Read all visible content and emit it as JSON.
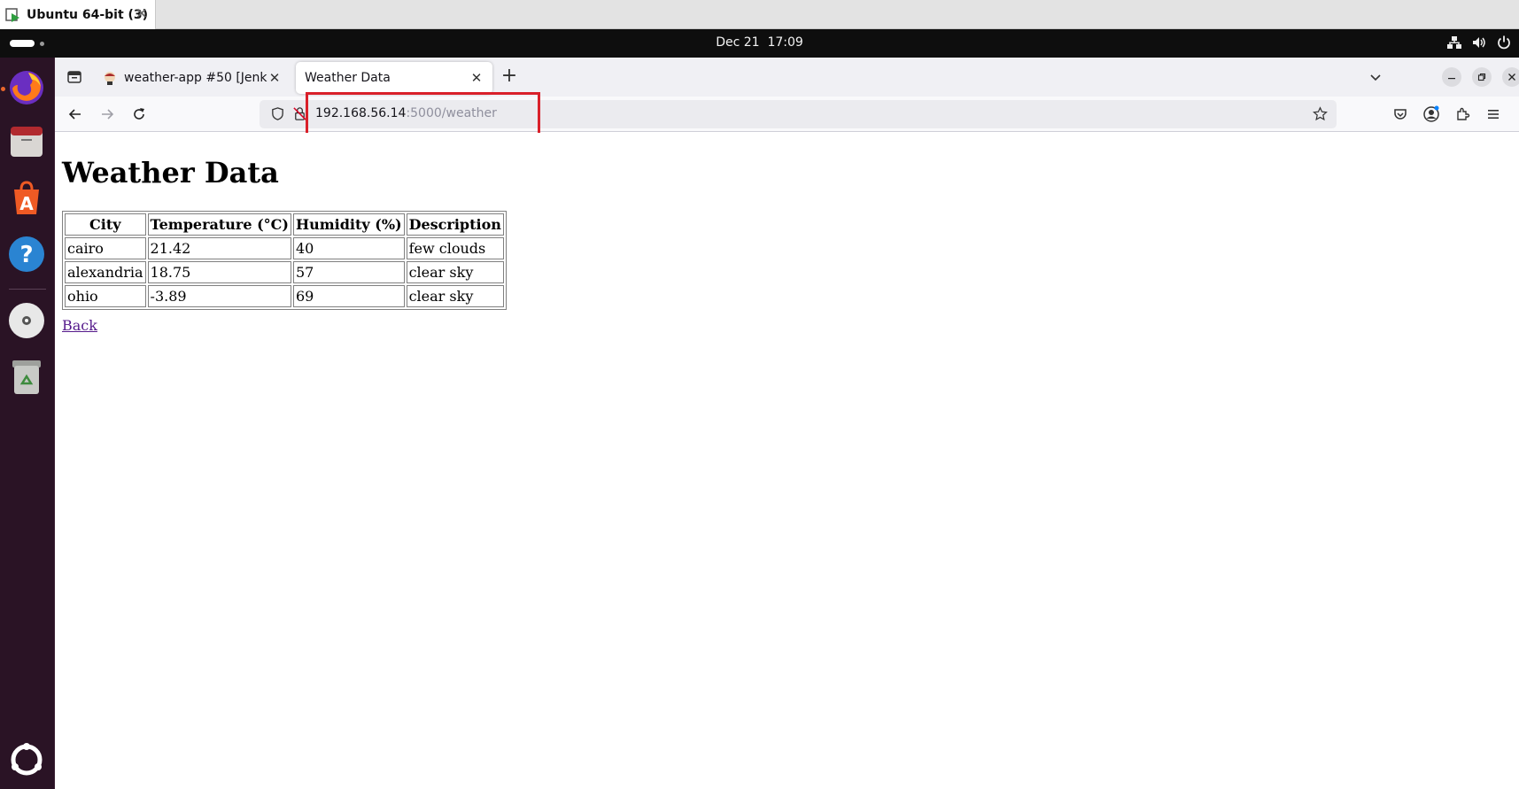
{
  "vm_window": {
    "title": "Ubuntu 64-bit (3)",
    "close_glyph": "✕"
  },
  "top_panel": {
    "date": "Dec 21",
    "time": "17:09"
  },
  "browser": {
    "tabs": [
      {
        "label": "weather-app #50 [Jenkins]",
        "active": false
      },
      {
        "label": "Weather Data",
        "active": true
      }
    ],
    "tab_close_glyph": "✕",
    "new_tab_glyph": "+",
    "url": {
      "host": "192.168.56.14",
      "rest": ":5000/weather"
    }
  },
  "page": {
    "heading": "Weather Data",
    "table": {
      "headers": [
        "City",
        "Temperature (°C)",
        "Humidity (%)",
        "Description"
      ],
      "rows": [
        [
          "cairo",
          "21.42",
          "40",
          "few clouds"
        ],
        [
          "alexandria",
          "18.75",
          "57",
          "clear sky"
        ],
        [
          "ohio",
          "-3.89",
          "69",
          "clear sky"
        ]
      ]
    },
    "back_link": "Back"
  },
  "colors": {
    "highlight": "#d9202a",
    "dock_bg": "#2a1325",
    "visited_link": "#551a8b"
  },
  "icons": {
    "dock": [
      "firefox-icon",
      "files-icon",
      "app-center-icon",
      "help-icon",
      "disc-icon",
      "trash-icon",
      "show-apps-icon"
    ],
    "tray": [
      "network-icon",
      "volume-icon",
      "power-icon"
    ]
  }
}
